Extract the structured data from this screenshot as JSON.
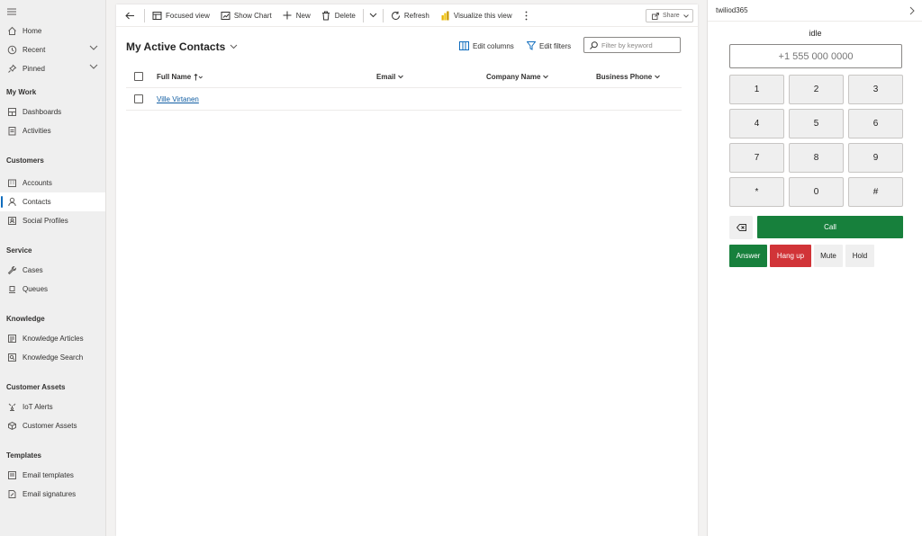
{
  "sidebar": {
    "top_items": [
      {
        "label": "Home",
        "icon": "home-icon"
      },
      {
        "label": "Recent",
        "icon": "clock-icon"
      },
      {
        "label": "Pinned",
        "icon": "pin-icon"
      }
    ],
    "groups": [
      {
        "title": "My Work",
        "items": [
          {
            "label": "Dashboards",
            "icon": "dashboard-icon"
          },
          {
            "label": "Activities",
            "icon": "clipboard-icon"
          }
        ]
      },
      {
        "title": "Customers",
        "items": [
          {
            "label": "Accounts",
            "icon": "building-icon"
          },
          {
            "label": "Contacts",
            "icon": "person-icon"
          },
          {
            "label": "Social Profiles",
            "icon": "profile-card-icon"
          }
        ]
      },
      {
        "title": "Service",
        "items": [
          {
            "label": "Cases",
            "icon": "wrench-icon"
          },
          {
            "label": "Queues",
            "icon": "queue-icon"
          }
        ]
      },
      {
        "title": "Knowledge",
        "items": [
          {
            "label": "Knowledge Articles",
            "icon": "article-icon"
          },
          {
            "label": "Knowledge Search",
            "icon": "book-search-icon"
          }
        ]
      },
      {
        "title": "Customer Assets",
        "items": [
          {
            "label": "IoT Alerts",
            "icon": "iot-alert-icon"
          },
          {
            "label": "Customer Assets",
            "icon": "asset-icon"
          }
        ]
      },
      {
        "title": "Templates",
        "items": [
          {
            "label": "Email templates",
            "icon": "email-template-icon"
          },
          {
            "label": "Email signatures",
            "icon": "signature-icon"
          }
        ]
      }
    ]
  },
  "commandbar": {
    "focused_view": "Focused view",
    "show_chart": "Show Chart",
    "new": "New",
    "delete": "Delete",
    "refresh": "Refresh",
    "visualize": "Visualize this view",
    "share": "Share"
  },
  "view": {
    "title": "My Active Contacts",
    "edit_columns": "Edit columns",
    "edit_filters": "Edit filters",
    "search_placeholder": "Filter by keyword"
  },
  "grid": {
    "columns": [
      "Full Name",
      "Email",
      "Company Name",
      "Business Phone"
    ],
    "rows": [
      {
        "full_name": "Ville Virtanen",
        "email": "",
        "company": "",
        "phone": ""
      }
    ]
  },
  "phone": {
    "app_name": "twiliod365",
    "status": "idle",
    "number_placeholder": "+1 555 000 0000",
    "keys": [
      "1",
      "2",
      "3",
      "4",
      "5",
      "6",
      "7",
      "8",
      "9",
      "*",
      "0",
      "#"
    ],
    "call": "Call",
    "answer": "Answer",
    "hangup": "Hang up",
    "mute": "Mute",
    "hold": "Hold",
    "call_color": "#17803c",
    "hangup_color": "#d13438"
  }
}
